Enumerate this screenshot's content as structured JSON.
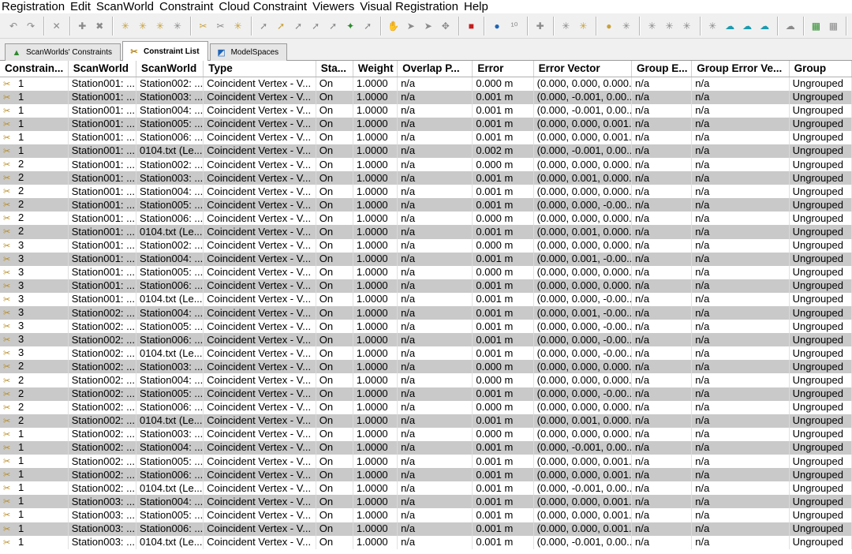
{
  "menu": [
    "Registration",
    "Edit",
    "ScanWorld",
    "Constraint",
    "Cloud Constraint",
    "Viewers",
    "Visual Registration",
    "Help"
  ],
  "toolbar_icons": [
    {
      "name": "undo-icon",
      "glyph": "↶",
      "tone": ""
    },
    {
      "name": "redo-icon",
      "glyph": "↷",
      "tone": ""
    },
    {
      "sep": true
    },
    {
      "name": "delete-icon",
      "glyph": "✕",
      "tone": ""
    },
    {
      "sep": true
    },
    {
      "name": "add-scanworld-icon",
      "glyph": "✚",
      "tone": ""
    },
    {
      "name": "remove-scanworld-icon",
      "glyph": "✖",
      "tone": ""
    },
    {
      "sep": true
    },
    {
      "name": "constraint-add-icon",
      "glyph": "✳",
      "tone": "gold"
    },
    {
      "name": "constraint-auto-icon",
      "glyph": "✳",
      "tone": "gold"
    },
    {
      "name": "constraint-link-icon",
      "glyph": "✳",
      "tone": "gold"
    },
    {
      "name": "constraint-cloud-icon",
      "glyph": "✳",
      "tone": ""
    },
    {
      "sep": true
    },
    {
      "name": "constraint-toggle-icon",
      "glyph": "✂",
      "tone": "gold"
    },
    {
      "name": "constraint-group-icon",
      "glyph": "✂",
      "tone": ""
    },
    {
      "name": "constraint-weight-icon",
      "glyph": "✳",
      "tone": "gold"
    },
    {
      "sep": true
    },
    {
      "name": "pick-icon",
      "glyph": "➚",
      "tone": ""
    },
    {
      "name": "pick-target-icon",
      "glyph": "➚",
      "tone": "gold"
    },
    {
      "name": "pick-vertex-icon",
      "glyph": "➚",
      "tone": ""
    },
    {
      "name": "pick-edge-icon",
      "glyph": "➚",
      "tone": ""
    },
    {
      "name": "pick-plane-icon",
      "glyph": "➚",
      "tone": ""
    },
    {
      "name": "pick-color-icon",
      "glyph": "✦",
      "tone": "green"
    },
    {
      "name": "pick-face-icon",
      "glyph": "➚",
      "tone": ""
    },
    {
      "sep": true
    },
    {
      "name": "hand-icon",
      "glyph": "✋",
      "tone": ""
    },
    {
      "name": "cursor-icon",
      "glyph": "➤",
      "tone": ""
    },
    {
      "name": "cursor-select-icon",
      "glyph": "➤",
      "tone": ""
    },
    {
      "name": "move-icon",
      "glyph": "✥",
      "tone": ""
    },
    {
      "sep": true
    },
    {
      "name": "lock-icon",
      "glyph": "■",
      "tone": "red"
    },
    {
      "sep": true
    },
    {
      "name": "globe-icon",
      "glyph": "●",
      "tone": "blue"
    },
    {
      "name": "scan-count-icon",
      "glyph": "¹⁰",
      "tone": ""
    },
    {
      "sep": true
    },
    {
      "name": "plus-icon",
      "glyph": "✚",
      "tone": ""
    },
    {
      "sep": true
    },
    {
      "name": "register-icon",
      "glyph": "✳",
      "tone": ""
    },
    {
      "name": "register-auto-icon",
      "glyph": "✳",
      "tone": "gold"
    },
    {
      "sep": true
    },
    {
      "name": "optimize-icon",
      "glyph": "●",
      "tone": "gold"
    },
    {
      "name": "optimize-star-icon",
      "glyph": "✳",
      "tone": ""
    },
    {
      "sep": true
    },
    {
      "name": "unify-icon",
      "glyph": "✳",
      "tone": ""
    },
    {
      "name": "unify-plus-icon",
      "glyph": "✳",
      "tone": ""
    },
    {
      "name": "unify-minus-icon",
      "glyph": "✳",
      "tone": ""
    },
    {
      "sep": true
    },
    {
      "name": "cloud-icon",
      "glyph": "✳",
      "tone": ""
    },
    {
      "name": "cloud-blue-icon",
      "glyph": "☁",
      "tone": "teal"
    },
    {
      "name": "cloud-sync-icon",
      "glyph": "☁",
      "tone": "teal"
    },
    {
      "name": "cloud-down-icon",
      "glyph": "☁",
      "tone": "teal"
    },
    {
      "sep": true
    },
    {
      "name": "cloud-settings-icon",
      "glyph": "☁",
      "tone": ""
    },
    {
      "sep": true
    },
    {
      "name": "grid-icon",
      "glyph": "▦",
      "tone": "green"
    },
    {
      "name": "grid-dots-icon",
      "glyph": "▦",
      "tone": ""
    },
    {
      "sep": true
    }
  ],
  "tabs": [
    {
      "label": "ScanWorlds' Constraints",
      "icon": "scanworlds-icon",
      "glyph": "▲",
      "active": false
    },
    {
      "label": "Constraint List",
      "icon": "constraint-list-icon",
      "glyph": "✂",
      "active": true
    },
    {
      "label": "ModelSpaces",
      "icon": "modelspaces-icon",
      "glyph": "◩",
      "active": false
    }
  ],
  "table": {
    "columns": [
      "Constrain...",
      "ScanWorld",
      "ScanWorld",
      "Type",
      "Sta...",
      "Weight",
      "Overlap P...",
      "Error",
      "Error Vector",
      "Group E...",
      "Group Error Ve...",
      "Group"
    ],
    "rows": [
      [
        "1",
        "Station001: ...",
        "Station002: ...",
        "Coincident Vertex - V...",
        "On",
        "1.0000",
        "n/a",
        "0.000 m",
        "(0.000, 0.000, 0.000...",
        "n/a",
        "n/a",
        "Ungrouped"
      ],
      [
        "1",
        "Station001: ...",
        "Station003: ...",
        "Coincident Vertex - V...",
        "On",
        "1.0000",
        "n/a",
        "0.001 m",
        "(0.000, -0.001, 0.00...",
        "n/a",
        "n/a",
        "Ungrouped"
      ],
      [
        "1",
        "Station001: ...",
        "Station004: ...",
        "Coincident Vertex - V...",
        "On",
        "1.0000",
        "n/a",
        "0.001 m",
        "(0.000, -0.001, 0.00...",
        "n/a",
        "n/a",
        "Ungrouped"
      ],
      [
        "1",
        "Station001: ...",
        "Station005: ...",
        "Coincident Vertex - V...",
        "On",
        "1.0000",
        "n/a",
        "0.001 m",
        "(0.000, 0.000, 0.001...",
        "n/a",
        "n/a",
        "Ungrouped"
      ],
      [
        "1",
        "Station001: ...",
        "Station006: ...",
        "Coincident Vertex - V...",
        "On",
        "1.0000",
        "n/a",
        "0.001 m",
        "(0.000, 0.000, 0.001...",
        "n/a",
        "n/a",
        "Ungrouped"
      ],
      [
        "1",
        "Station001: ...",
        "0104.txt (Le...",
        "Coincident Vertex - V...",
        "On",
        "1.0000",
        "n/a",
        "0.002 m",
        "(0.000, -0.001, 0.00...",
        "n/a",
        "n/a",
        "Ungrouped"
      ],
      [
        "2",
        "Station001: ...",
        "Station002: ...",
        "Coincident Vertex - V...",
        "On",
        "1.0000",
        "n/a",
        "0.000 m",
        "(0.000, 0.000, 0.000...",
        "n/a",
        "n/a",
        "Ungrouped"
      ],
      [
        "2",
        "Station001: ...",
        "Station003: ...",
        "Coincident Vertex - V...",
        "On",
        "1.0000",
        "n/a",
        "0.001 m",
        "(0.000, 0.001, 0.000...",
        "n/a",
        "n/a",
        "Ungrouped"
      ],
      [
        "2",
        "Station001: ...",
        "Station004: ...",
        "Coincident Vertex - V...",
        "On",
        "1.0000",
        "n/a",
        "0.001 m",
        "(0.000, 0.000, 0.000...",
        "n/a",
        "n/a",
        "Ungrouped"
      ],
      [
        "2",
        "Station001: ...",
        "Station005: ...",
        "Coincident Vertex - V...",
        "On",
        "1.0000",
        "n/a",
        "0.001 m",
        "(0.000, 0.000, -0.00...",
        "n/a",
        "n/a",
        "Ungrouped"
      ],
      [
        "2",
        "Station001: ...",
        "Station006: ...",
        "Coincident Vertex - V...",
        "On",
        "1.0000",
        "n/a",
        "0.000 m",
        "(0.000, 0.000, 0.000...",
        "n/a",
        "n/a",
        "Ungrouped"
      ],
      [
        "2",
        "Station001: ...",
        "0104.txt (Le...",
        "Coincident Vertex - V...",
        "On",
        "1.0000",
        "n/a",
        "0.001 m",
        "(0.000, 0.001, 0.000...",
        "n/a",
        "n/a",
        "Ungrouped"
      ],
      [
        "3",
        "Station001: ...",
        "Station002: ...",
        "Coincident Vertex - V...",
        "On",
        "1.0000",
        "n/a",
        "0.000 m",
        "(0.000, 0.000, 0.000...",
        "n/a",
        "n/a",
        "Ungrouped"
      ],
      [
        "3",
        "Station001: ...",
        "Station004: ...",
        "Coincident Vertex - V...",
        "On",
        "1.0000",
        "n/a",
        "0.001 m",
        "(0.000, 0.001, -0.00...",
        "n/a",
        "n/a",
        "Ungrouped"
      ],
      [
        "3",
        "Station001: ...",
        "Station005: ...",
        "Coincident Vertex - V...",
        "On",
        "1.0000",
        "n/a",
        "0.000 m",
        "(0.000, 0.000, 0.000...",
        "n/a",
        "n/a",
        "Ungrouped"
      ],
      [
        "3",
        "Station001: ...",
        "Station006: ...",
        "Coincident Vertex - V...",
        "On",
        "1.0000",
        "n/a",
        "0.001 m",
        "(0.000, 0.000, 0.000...",
        "n/a",
        "n/a",
        "Ungrouped"
      ],
      [
        "3",
        "Station001: ...",
        "0104.txt (Le...",
        "Coincident Vertex - V...",
        "On",
        "1.0000",
        "n/a",
        "0.001 m",
        "(0.000, 0.000, -0.00...",
        "n/a",
        "n/a",
        "Ungrouped"
      ],
      [
        "3",
        "Station002: ...",
        "Station004: ...",
        "Coincident Vertex - V...",
        "On",
        "1.0000",
        "n/a",
        "0.001 m",
        "(0.000, 0.001, -0.00...",
        "n/a",
        "n/a",
        "Ungrouped"
      ],
      [
        "3",
        "Station002: ...",
        "Station005: ...",
        "Coincident Vertex - V...",
        "On",
        "1.0000",
        "n/a",
        "0.001 m",
        "(0.000, 0.000, -0.00...",
        "n/a",
        "n/a",
        "Ungrouped"
      ],
      [
        "3",
        "Station002: ...",
        "Station006: ...",
        "Coincident Vertex - V...",
        "On",
        "1.0000",
        "n/a",
        "0.001 m",
        "(0.000, 0.000, -0.00...",
        "n/a",
        "n/a",
        "Ungrouped"
      ],
      [
        "3",
        "Station002: ...",
        "0104.txt (Le...",
        "Coincident Vertex - V...",
        "On",
        "1.0000",
        "n/a",
        "0.001 m",
        "(0.000, 0.000, -0.00...",
        "n/a",
        "n/a",
        "Ungrouped"
      ],
      [
        "2",
        "Station002: ...",
        "Station003: ...",
        "Coincident Vertex - V...",
        "On",
        "1.0000",
        "n/a",
        "0.000 m",
        "(0.000, 0.000, 0.000...",
        "n/a",
        "n/a",
        "Ungrouped"
      ],
      [
        "2",
        "Station002: ...",
        "Station004: ...",
        "Coincident Vertex - V...",
        "On",
        "1.0000",
        "n/a",
        "0.000 m",
        "(0.000, 0.000, 0.000...",
        "n/a",
        "n/a",
        "Ungrouped"
      ],
      [
        "2",
        "Station002: ...",
        "Station005: ...",
        "Coincident Vertex - V...",
        "On",
        "1.0000",
        "n/a",
        "0.001 m",
        "(0.000, 0.000, -0.00...",
        "n/a",
        "n/a",
        "Ungrouped"
      ],
      [
        "2",
        "Station002: ...",
        "Station006: ...",
        "Coincident Vertex - V...",
        "On",
        "1.0000",
        "n/a",
        "0.000 m",
        "(0.000, 0.000, 0.000...",
        "n/a",
        "n/a",
        "Ungrouped"
      ],
      [
        "2",
        "Station002: ...",
        "0104.txt (Le...",
        "Coincident Vertex - V...",
        "On",
        "1.0000",
        "n/a",
        "0.001 m",
        "(0.000, 0.001, 0.000...",
        "n/a",
        "n/a",
        "Ungrouped"
      ],
      [
        "1",
        "Station002: ...",
        "Station003: ...",
        "Coincident Vertex - V...",
        "On",
        "1.0000",
        "n/a",
        "0.000 m",
        "(0.000, 0.000, 0.000...",
        "n/a",
        "n/a",
        "Ungrouped"
      ],
      [
        "1",
        "Station002: ...",
        "Station004: ...",
        "Coincident Vertex - V...",
        "On",
        "1.0000",
        "n/a",
        "0.001 m",
        "(0.000, -0.001, 0.00...",
        "n/a",
        "n/a",
        "Ungrouped"
      ],
      [
        "1",
        "Station002: ...",
        "Station005: ...",
        "Coincident Vertex - V...",
        "On",
        "1.0000",
        "n/a",
        "0.001 m",
        "(0.000, 0.000, 0.001...",
        "n/a",
        "n/a",
        "Ungrouped"
      ],
      [
        "1",
        "Station002: ...",
        "Station006: ...",
        "Coincident Vertex - V...",
        "On",
        "1.0000",
        "n/a",
        "0.001 m",
        "(0.000, 0.000, 0.001...",
        "n/a",
        "n/a",
        "Ungrouped"
      ],
      [
        "1",
        "Station002: ...",
        "0104.txt (Le...",
        "Coincident Vertex - V...",
        "On",
        "1.0000",
        "n/a",
        "0.001 m",
        "(0.000, -0.001, 0.00...",
        "n/a",
        "n/a",
        "Ungrouped"
      ],
      [
        "1",
        "Station003: ...",
        "Station004: ...",
        "Coincident Vertex - V...",
        "On",
        "1.0000",
        "n/a",
        "0.001 m",
        "(0.000, 0.000, 0.001...",
        "n/a",
        "n/a",
        "Ungrouped"
      ],
      [
        "1",
        "Station003: ...",
        "Station005: ...",
        "Coincident Vertex - V...",
        "On",
        "1.0000",
        "n/a",
        "0.001 m",
        "(0.000, 0.000, 0.001...",
        "n/a",
        "n/a",
        "Ungrouped"
      ],
      [
        "1",
        "Station003: ...",
        "Station006: ...",
        "Coincident Vertex - V...",
        "On",
        "1.0000",
        "n/a",
        "0.001 m",
        "(0.000, 0.000, 0.001...",
        "n/a",
        "n/a",
        "Ungrouped"
      ],
      [
        "1",
        "Station003: ...",
        "0104.txt (Le...",
        "Coincident Vertex - V...",
        "On",
        "1.0000",
        "n/a",
        "0.001 m",
        "(0.000, -0.001, 0.00...",
        "n/a",
        "n/a",
        "Ungrouped"
      ]
    ]
  }
}
